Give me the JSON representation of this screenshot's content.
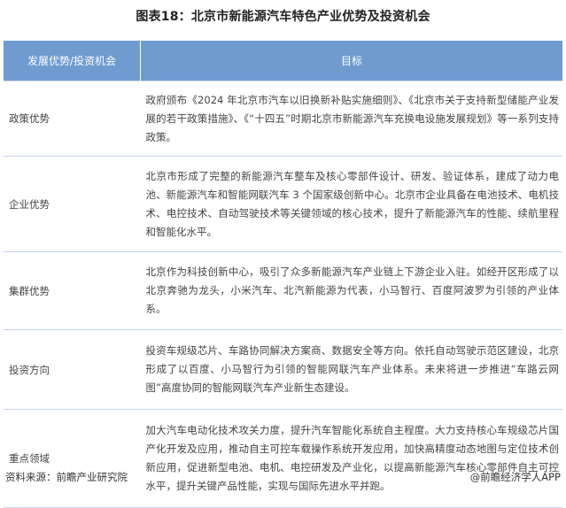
{
  "title": "图表18：北京市新能源汽车特色产业优势及投资机会",
  "table": {
    "headers": [
      "发展优势/投资机会",
      "目标"
    ],
    "rows": [
      {
        "label": "政策优势",
        "text": "政府颁布《2024 年北京市汽车以旧换新补贴实施细则》、《北京市关于支持新型储能产业发展的若干政策措施》、《“十四五”时期北京市新能源汽车充换电设施发展规划》等一系列支持政策。"
      },
      {
        "label": "企业优势",
        "text": "北京市形成了完整的新能源汽车整车及核心零部件设计、研发、验证体系，建成了动力电池、新能源汽车和智能网联汽车 3 个国家级创新中心。北京市企业具备在电池技术、电机技术、电控技术、自动驾驶技术等关键领域的核心技术，提升了新能源汽车的性能、续航里程和智能化水平。"
      },
      {
        "label": "集群优势",
        "text": "北京作为科技创新中心，吸引了众多新能源汽车产业链上下游企业入驻。如经开区形成了以北京奔驰为龙头，小米汽车、北汽新能源为代表，小马智行、百度阿波罗为引领的产业体系。"
      },
      {
        "label": "投资方向",
        "text": "投资车规级芯片、车路协同解决方案商、数据安全等方向。依托自动驾驶示范区建设，北京形成了以百度、小马智行为引领的智能网联汽车产业体系。未来将进一步推进“车路云网图”高度协同的智能网联汽车产业新生态建设。"
      },
      {
        "label": "重点领域",
        "text": "加大汽车电动化技术攻关力度，提升汽车智能化系统自主程度。大力支持核心车规级芯片国产化开发及应用，推动自主可控车载操作系统开发应用，加快高精度动态地图与定位技术创新应用，促进新型电池、电机、电控研发及产业化，以提高新能源汽车核心零部件自主可控水平，提升关键产品性能，实现与国际先进水平并跑。"
      }
    ]
  },
  "footer": {
    "source": "资料来源：前瞻产业研究院",
    "brand": "@前瞻经济学人APP"
  },
  "colors": {
    "header_bg": "#6f9bd1",
    "header_text": "#ffffff",
    "row_border": "#c9d6e6"
  }
}
